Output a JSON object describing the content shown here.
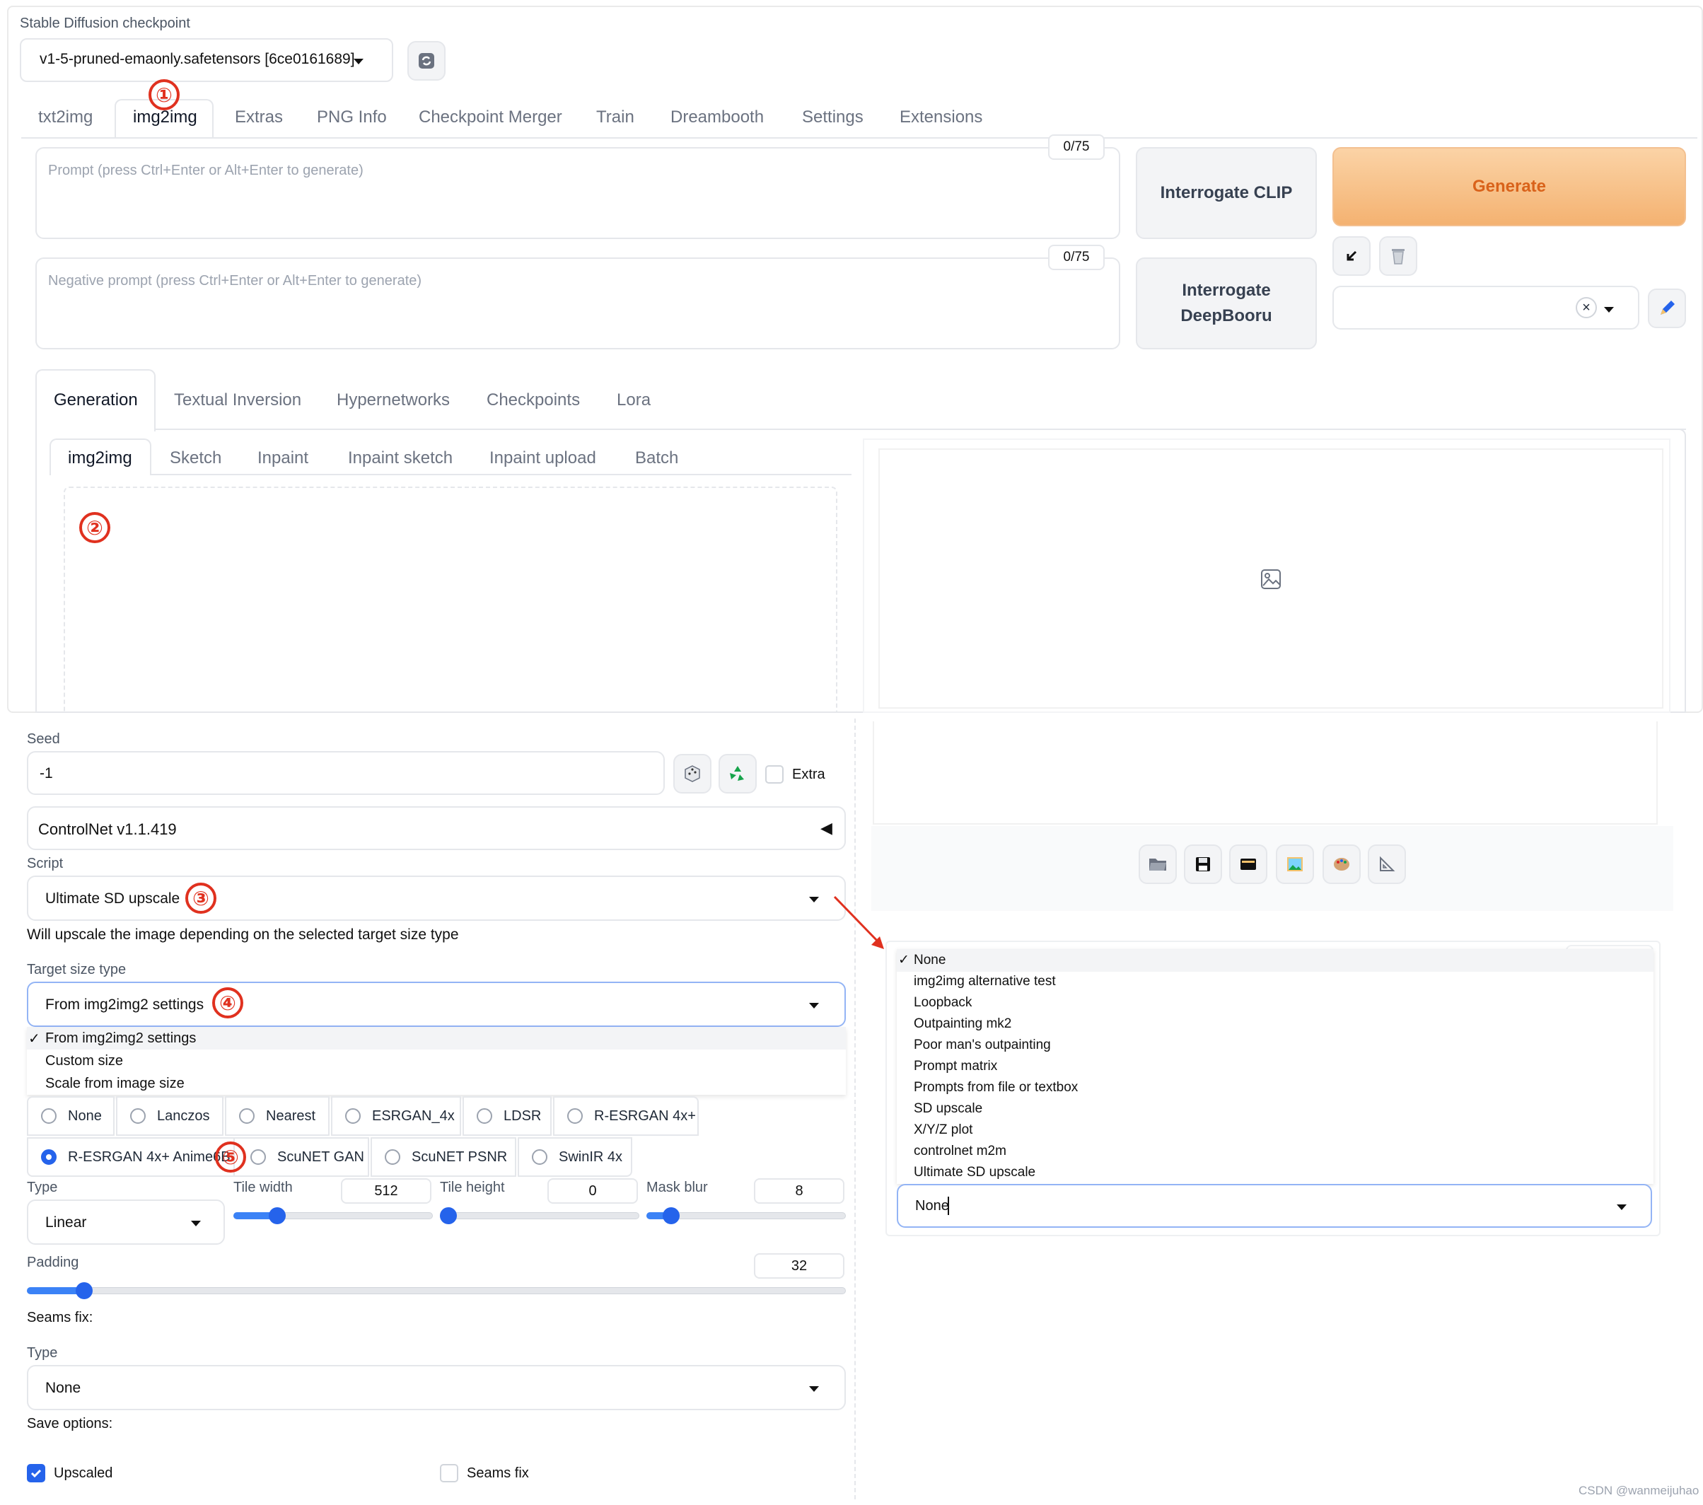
{
  "checkpoint": {
    "label": "Stable Diffusion checkpoint",
    "value": "v1-5-pruned-emaonly.safetensors [6ce0161689]"
  },
  "main_tabs": [
    "txt2img",
    "img2img",
    "Extras",
    "PNG Info",
    "Checkpoint Merger",
    "Train",
    "Dreambooth",
    "Settings",
    "Extensions"
  ],
  "prompt": {
    "placeholder": "Prompt (press Ctrl+Enter or Alt+Enter to generate)",
    "counter": "0/75"
  },
  "negative_prompt": {
    "placeholder": "Negative prompt (press Ctrl+Enter or Alt+Enter to generate)",
    "counter": "0/75"
  },
  "buttons": {
    "interrogate_clip": "Interrogate CLIP",
    "interrogate_deepbooru": "Interrogate DeepBooru",
    "generate": "Generate"
  },
  "styles_clear": "×",
  "sub_tabs": [
    "Generation",
    "Textual Inversion",
    "Hypernetworks",
    "Checkpoints",
    "Lora"
  ],
  "mode_tabs": [
    "img2img",
    "Sketch",
    "Inpaint",
    "Inpaint sketch",
    "Inpaint upload",
    "Batch"
  ],
  "annotations": [
    "①",
    "②",
    "③",
    "④",
    "⑤"
  ],
  "seed": {
    "label": "Seed",
    "value": "-1",
    "extra_label": "Extra"
  },
  "controlnet": {
    "label": "ControlNet v1.1.419",
    "toggle": "◀"
  },
  "script": {
    "label": "Script",
    "value": "Ultimate SD upscale",
    "description": "Will upscale the image depending on the selected target size type"
  },
  "target_size": {
    "label": "Target size type",
    "value": "From img2img2 settings",
    "options": [
      "From img2img2 settings",
      "Custom size",
      "Scale from image size"
    ],
    "check": "✓"
  },
  "upscalers": {
    "row1": [
      "None",
      "Lanczos",
      "Nearest",
      "ESRGAN_4x",
      "LDSR",
      "R-ESRGAN 4x+"
    ],
    "row2": [
      "R-ESRGAN 4x+ Anime6B",
      "ScuNET GAN",
      "ScuNET PSNR",
      "SwinIR 4x"
    ],
    "selected": "R-ESRGAN 4x+ Anime6B"
  },
  "redraw": {
    "type_label": "Type",
    "type_value": "Linear",
    "tile_width": {
      "label": "Tile width",
      "value": "512",
      "fraction": 0.22
    },
    "tile_height": {
      "label": "Tile height",
      "value": "0",
      "fraction": 0.0
    },
    "mask_blur": {
      "label": "Mask blur",
      "value": "8",
      "fraction": 0.125
    }
  },
  "padding": {
    "label": "Padding",
    "value": "32",
    "fraction": 0.07
  },
  "seams": {
    "label": "Seams fix:",
    "type_label": "Type",
    "type_value": "None"
  },
  "save_options": {
    "label": "Save options:",
    "upscaled": "Upscaled",
    "upscaled_checked": true,
    "seams_fix": "Seams fix",
    "seams_fix_checked": false
  },
  "script_dropdown": {
    "check": "✓",
    "items": [
      "None",
      "img2img alternative test",
      "Loopback",
      "Outpainting mk2",
      "Poor man's outpainting",
      "Prompt matrix",
      "Prompts from file or textbox",
      "SD upscale",
      "X/Y/Z plot",
      "controlnet m2m",
      "Ultimate SD upscale"
    ],
    "current": "None"
  },
  "watermark": "CSDN @wanmeijuhao",
  "icons": [
    "refresh-icon",
    "arrow-down-left-icon",
    "trash-icon",
    "pencil-icon",
    "image-placeholder-icon",
    "dice-icon",
    "recycle-icon",
    "folder-icon",
    "save-icon",
    "zip-icon",
    "picture-icon",
    "palette-icon",
    "ruler-icon"
  ],
  "colors": {
    "accent": "#2563eb",
    "generate_bg": "#f7c08a",
    "generate_text": "#d9621a",
    "annotation_red": "#e0311f"
  }
}
